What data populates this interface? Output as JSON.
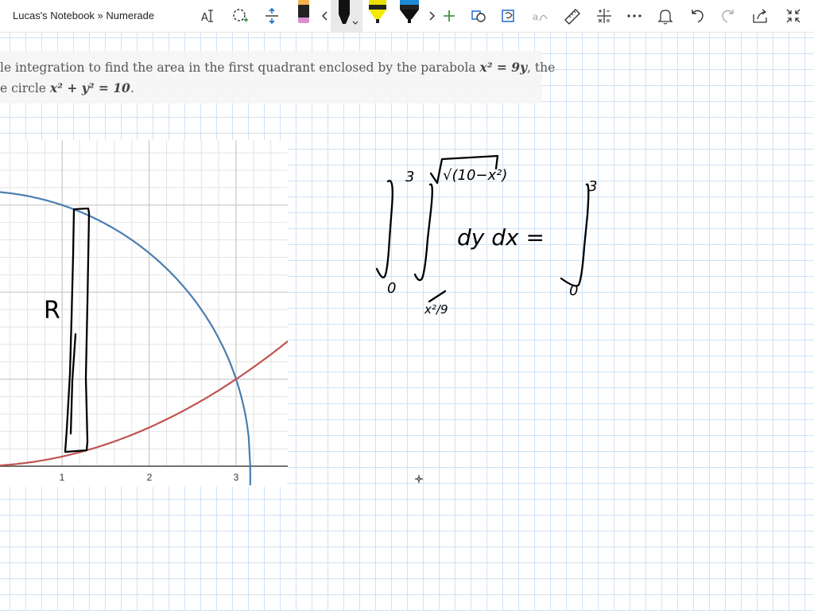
{
  "toolbar": {
    "breadcrumb": "Lucas's Notebook » Numerade",
    "tools": [
      "text-select-icon",
      "lasso-select-icon",
      "insert-space-icon",
      "pen-pink-icon",
      "chevron-left-icon",
      "pen-black-icon",
      "highlighter-yellow-icon",
      "pen-blue-icon",
      "chevron-right-icon",
      "add-pen-icon",
      "shapes-icon",
      "ink-to-shape-icon",
      "ink-to-math-icon",
      "ruler-icon",
      "math-icon",
      "more-icon",
      "bell-icon",
      "undo-icon",
      "redo-icon",
      "share-icon",
      "fullscreen-icon"
    ]
  },
  "question": {
    "line1_text": "le integration to find the area in the first quadrant enclosed by the parabola ",
    "line1_math1": "x² = 9y",
    "line1_end": ", the",
    "line2_text": "e circle ",
    "line2_math": "x² + y² = 10",
    "line2_end": "."
  },
  "graph": {
    "x_ticks": [
      "1",
      "2",
      "3"
    ],
    "circle_color": "#4a7eb0",
    "parabola_color": "#c0544f",
    "grid_color": "#c8c8c8",
    "axis_color": "#444444",
    "region_label": "R"
  },
  "handwriting": {
    "outer_lower": "0",
    "outer_upper": "3",
    "inner_upper": "√(10−x²)",
    "inner_lower": "x²/9",
    "differentials": "dy dx =",
    "rhs_lower": "0",
    "rhs_upper": "3"
  }
}
